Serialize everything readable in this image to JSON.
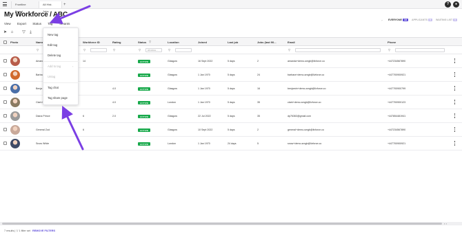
{
  "tabs": [
    {
      "label": "Frontline Board"
    },
    {
      "label": "All Hist. Jobs"
    }
  ],
  "title": "My Workforce / ABC",
  "nav": {
    "view": "View",
    "export": "Export",
    "status": "Status",
    "tag": "Tag",
    "tenants": "Tenants"
  },
  "audience": {
    "everyone": {
      "label": "EVERYONE",
      "count": "18"
    },
    "applicants": {
      "label": "APPLICANTS",
      "count": "0"
    },
    "waiting": {
      "label": "WAITING LIST",
      "count": "0"
    }
  },
  "columns": {
    "photo": "Photo",
    "name": "Name",
    "workforce_id": "Workforce ID",
    "rating": "Rating",
    "status": "Status",
    "location": "Location",
    "joined": "Joined",
    "last_job": "Last job",
    "jobs": "Jobs (last 90...",
    "email": "Email",
    "phone": "Phone"
  },
  "filters": {
    "status_select": "All Active..."
  },
  "rows": [
    {
      "name": "Amand",
      "workforce_id": "14",
      "rating": "",
      "status": "ACTIVE",
      "location": "Glasgow",
      "joined": "16 Sept 2022",
      "last_job": "5 days",
      "jobs": "2",
      "email": "amanda+demo-smgb@livforce.co",
      "phone": "+447234567890",
      "avatar": "#b85c4a"
    },
    {
      "name": "Barba",
      "workforce_id": "",
      "rating": "",
      "status": "ACTIVE",
      "location": "Glasgow",
      "joined": "1 Jan 1970",
      "last_job": "5 days",
      "jobs": "24",
      "email": "barbara+demo-smgb@livforce.co",
      "phone": "+447700900921",
      "avatar": "#d16a2e"
    },
    {
      "name": "Benja",
      "workforce_id": "",
      "rating": "4.0",
      "status": "ACTIVE",
      "location": "Glasgow",
      "joined": "1 Jan 1970",
      "last_job": "5 days",
      "jobs": "16",
      "email": "benjamin+demo-smgb@livforce.co",
      "phone": "+447700900799",
      "avatar": "#4a6fa8"
    },
    {
      "name": "Clark Kent",
      "workforce_id": "",
      "rating": "4.0",
      "status": "ACTIVE",
      "location": "London",
      "joined": "1 Jan 1970",
      "last_job": "5 days",
      "jobs": "35",
      "email": "clark+demo-smgb@livforce.co",
      "phone": "+447700900123",
      "avatar": "#8a7a62"
    },
    {
      "name": "Diana Prince",
      "workforce_id": "6",
      "rating": "2.0",
      "status": "ACTIVE",
      "location": "Glasgow",
      "joined": "22 Jul 2022",
      "last_job": "5 days",
      "jobs": "35",
      "email": "dp76363@gmail.com",
      "phone": "+447854481941",
      "avatar": "#9a9a9a"
    },
    {
      "name": "General Zod",
      "workforce_id": "6",
      "rating": "",
      "status": "ACTIVE",
      "location": "Glasgow",
      "joined": "10 Sept 2022",
      "last_job": "5 days",
      "jobs": "2",
      "email": "general+demo-smgb@livforce.co",
      "phone": "+447234567890",
      "avatar": "#c9a99a"
    },
    {
      "name": "Snow White",
      "workforce_id": "",
      "rating": "",
      "status": "ACTIVE",
      "location": "London",
      "joined": "1 Jan 1970",
      "last_job": "24 days",
      "jobs": "5",
      "email": "snow+demo-smgb@livforce.co",
      "phone": "+447700900921",
      "avatar": "#3e4a66"
    }
  ],
  "dropdown": {
    "new_tag": "New tag",
    "edit_tag": "Edit tag",
    "delete_tag": "Delete tag",
    "add_to_tag": "Add to tag",
    "untag": "Untag",
    "tag_chat": "Tag chat",
    "tag_share_page": "Tag share page"
  },
  "footer": {
    "results": "7 results",
    "filter_set": "1 filter set",
    "remove": "REMOVE FILTERS"
  },
  "colors": {
    "accent": "#5b49d9",
    "active": "#18a94b",
    "arrow": "#7b3fe4"
  }
}
